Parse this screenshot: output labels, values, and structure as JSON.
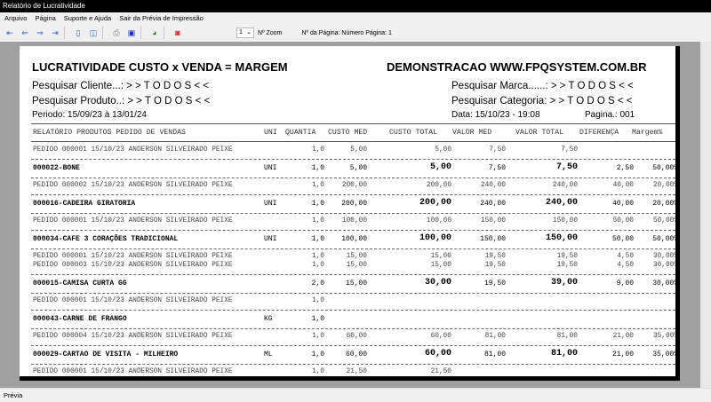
{
  "window": {
    "title": "Relatório de Lucratividade"
  },
  "menu": [
    "Arquivo",
    "Página",
    "Suporte e Ajuda",
    "Sair da Prévia de Impressão"
  ],
  "toolbar": {
    "zoom_value": "1",
    "zoom_label": "Nº Zoom",
    "page_label": "Nº da Página: Número Página: 1"
  },
  "report": {
    "title": "LUCRATIVIDADE CUSTO x VENDA = MARGEM",
    "company": "DEMONSTRACAO WWW.FPQSYSTEM.COM.BR",
    "filter_cliente": "Pesquisar Cliente...: > >  T O D O S  < <",
    "filter_produto": "Pesquisar Produto..: > >  T O D O S  < <",
    "filter_marca": "Pesquisar Marca......: > >  T O D O S  < <",
    "filter_categoria": "Pesquisar Categoria: > >  T O D O S  < <",
    "periodo": "Periodo: 15/09/23 à 13/01/24",
    "data": "Data: 15/10/23 - 19:08",
    "pagina": "Pagina.: 001",
    "columns": {
      "desc": "RELATÓRIO PRODUTOS PEDIDO DE VENDAS",
      "uni": "UNI",
      "qty": "QUANTIA",
      "cmed": "CUSTO MED",
      "ctot": "CUSTO TOTAL",
      "vmed": "VALOR MED",
      "vtot": "VALOR TOTAL",
      "dif": "DIFERENÇA",
      "marg": "Margem%"
    },
    "groups": [
      {
        "orders": [
          {
            "desc": "PEDIDO 000001  15/10/23  ANDERSON SILVEIRADO PEIXE",
            "qty": "1,0",
            "cmed": "5,00",
            "ctot": "5,00",
            "vmed": "7,50",
            "vtot": "7,50",
            "dif": "",
            "marg": ""
          }
        ],
        "product": {
          "desc": "000022-BONE",
          "uni": "UNI",
          "qty": "1,0",
          "cmed": "5,00",
          "ctot": "5,00",
          "vmed": "7,50",
          "vtot": "7,50",
          "dif": "2,50",
          "marg": "50,00%"
        }
      },
      {
        "orders": [
          {
            "desc": "PEDIDO 000002  15/10/23  ANDERSON SILVEIRADO PEIXE",
            "qty": "1,0",
            "cmed": "200,00",
            "ctot": "200,00",
            "vmed": "240,00",
            "vtot": "240,00",
            "dif": "40,00",
            "marg": "20,00%"
          }
        ],
        "product": {
          "desc": "000016-CADEIRA GIRATORIA",
          "uni": "UNI",
          "qty": "1,0",
          "cmed": "200,00",
          "ctot": "200,00",
          "vmed": "240,00",
          "vtot": "240,00",
          "dif": "40,00",
          "marg": "20,00%"
        }
      },
      {
        "orders": [
          {
            "desc": "PEDIDO 000001  15/10/23  ANDERSON SILVEIRADO PEIXE",
            "qty": "1,0",
            "cmed": "100,00",
            "ctot": "100,00",
            "vmed": "150,00",
            "vtot": "150,00",
            "dif": "50,00",
            "marg": "50,00%"
          }
        ],
        "product": {
          "desc": "000034-CAFE 3 CORAÇÕES TRADICIONAL",
          "uni": "UNI",
          "qty": "1,0",
          "cmed": "100,00",
          "ctot": "100,00",
          "vmed": "150,00",
          "vtot": "150,00",
          "dif": "50,00",
          "marg": "50,00%"
        }
      },
      {
        "orders": [
          {
            "desc": "PEDIDO 000001  15/10/23  ANDERSON SILVEIRADO PEIXE",
            "qty": "1,0",
            "cmed": "15,00",
            "ctot": "15,00",
            "vmed": "19,50",
            "vtot": "19,50",
            "dif": "4,50",
            "marg": "30,00%"
          },
          {
            "desc": "PEDIDO 000003  15/10/23  ANDERSON SILVEIRADO PEIXE",
            "qty": "1,0",
            "cmed": "15,00",
            "ctot": "15,00",
            "vmed": "19,50",
            "vtot": "19,50",
            "dif": "4,50",
            "marg": "30,00%"
          }
        ],
        "product": {
          "desc": "000015-CAMISA CURTA GG",
          "uni": "",
          "qty": "2,0",
          "cmed": "15,00",
          "ctot": "30,00",
          "vmed": "19,50",
          "vtot": "39,00",
          "dif": "9,00",
          "marg": "30,00%"
        }
      },
      {
        "orders": [
          {
            "desc": "PEDIDO 000001  15/10/23  ANDERSON SILVEIRADO PEIXE",
            "qty": "1,0",
            "cmed": "",
            "ctot": "",
            "vmed": "",
            "vtot": "",
            "dif": "",
            "marg": ""
          }
        ],
        "product": {
          "desc": "000043-CARNE DE FRANGO",
          "uni": "KG",
          "qty": "1,0",
          "cmed": "",
          "ctot": "",
          "vmed": "",
          "vtot": "",
          "dif": "",
          "marg": ""
        }
      },
      {
        "orders": [
          {
            "desc": "PEDIDO 000004  15/10/23  ANDERSON SILVEIRADO PEIXE",
            "qty": "1,0",
            "cmed": "60,00",
            "ctot": "60,00",
            "vmed": "81,00",
            "vtot": "81,00",
            "dif": "21,00",
            "marg": "35,00%"
          }
        ],
        "product": {
          "desc": "000029-CARTAO DE VISITA - MILHEIRO",
          "uni": "ML",
          "qty": "1,0",
          "cmed": "60,00",
          "ctot": "60,00",
          "vmed": "81,00",
          "vtot": "81,00",
          "dif": "21,00",
          "marg": "35,00%"
        }
      },
      {
        "orders": [
          {
            "desc": "PEDIDO 000001  15/10/23  ANDERSON SILVEIRADO PEIXE",
            "qty": "1,0",
            "cmed": "21,50",
            "ctot": "21,50",
            "vmed": "",
            "vtot": "",
            "dif": "",
            "marg": ""
          }
        ]
      }
    ]
  },
  "status": {
    "text": "Prévia"
  }
}
